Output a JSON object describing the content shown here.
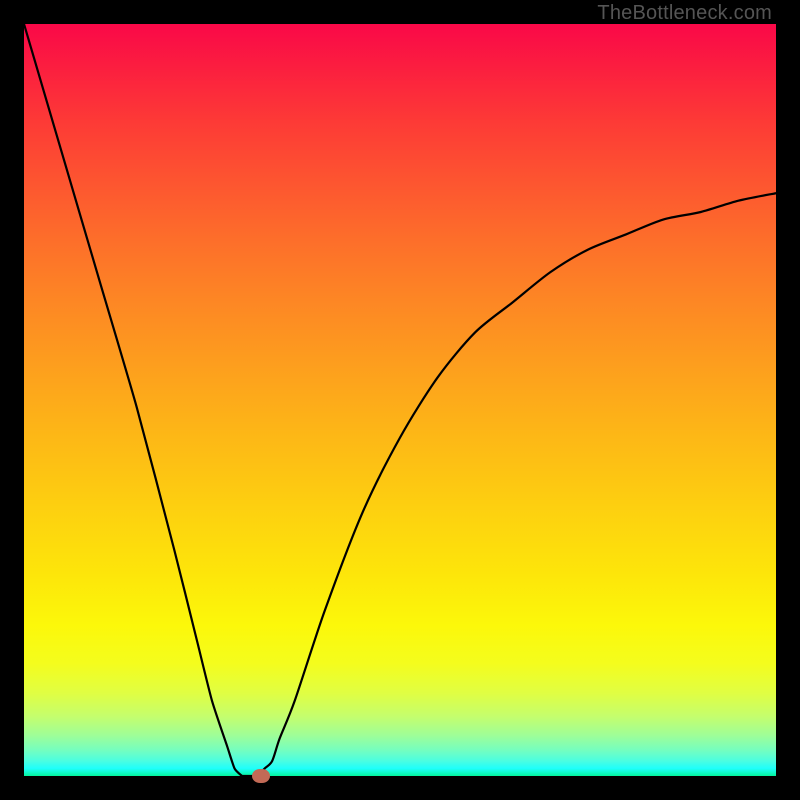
{
  "attribution": "TheBottleneck.com",
  "chart_data": {
    "type": "line",
    "title": "",
    "xlabel": "",
    "ylabel": "",
    "x_range": [
      0,
      100
    ],
    "y_range": [
      0,
      100
    ],
    "series": [
      {
        "name": "bottleneck-curve",
        "x": [
          0,
          5,
          10,
          15,
          20,
          23,
          25,
          27,
          28,
          29,
          30,
          31,
          32,
          33,
          34,
          36,
          40,
          45,
          50,
          55,
          60,
          65,
          70,
          75,
          80,
          85,
          90,
          95,
          100
        ],
        "y": [
          100,
          83,
          66,
          49,
          30,
          18,
          10,
          4,
          1,
          0,
          0,
          0,
          1,
          2,
          5,
          10,
          22,
          35,
          45,
          53,
          59,
          63,
          67,
          70,
          72,
          74,
          75,
          76.5,
          77.5
        ]
      }
    ],
    "flat_bottom": {
      "x_start": 29,
      "x_end": 31,
      "y": 0
    },
    "marker": {
      "x": 31.5,
      "y": 0
    },
    "gradient": {
      "top_color": "#fa0848",
      "bottom_color": "#02f59e"
    }
  }
}
